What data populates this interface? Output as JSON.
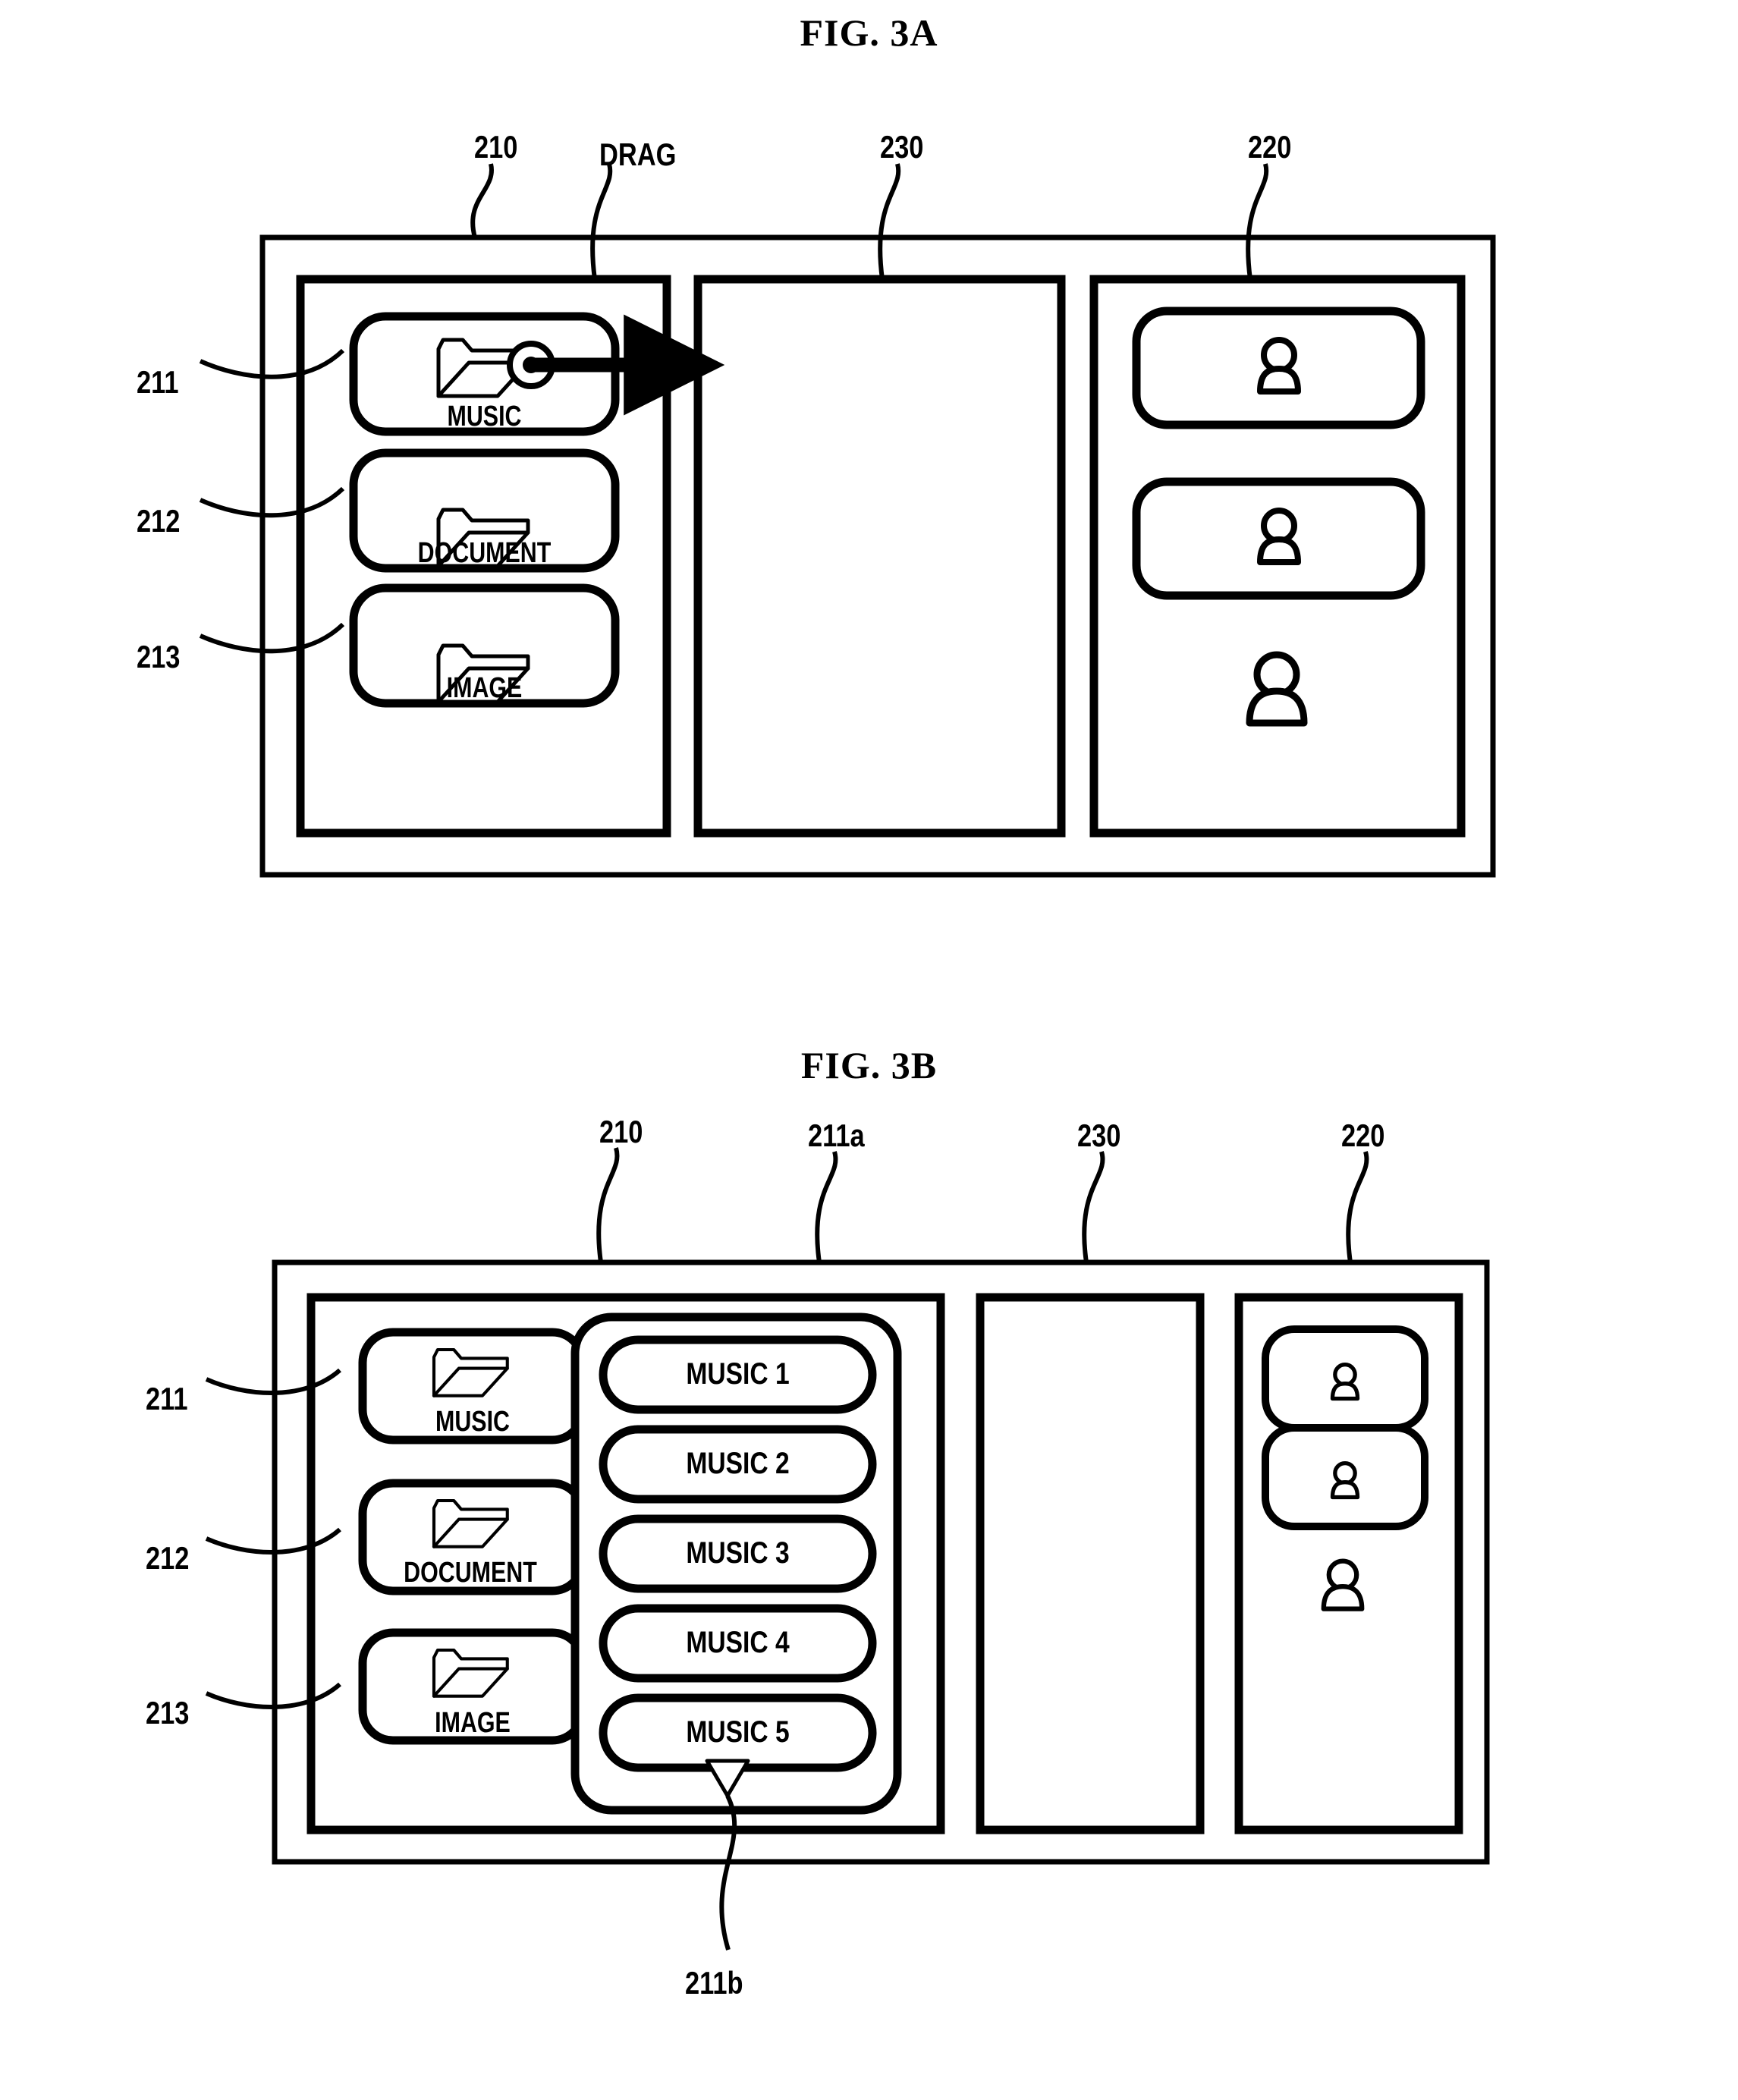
{
  "figures": [
    {
      "id": "fig-3a",
      "title": "FIG. 3A",
      "callouts": [
        {
          "name": "device-frame",
          "text": "210"
        },
        {
          "name": "drag-gesture",
          "text": "DRAG"
        },
        {
          "name": "center-panel",
          "text": "230"
        },
        {
          "name": "right-panel",
          "text": "220"
        },
        {
          "name": "music-folder",
          "text": "211"
        },
        {
          "name": "document-folder",
          "text": "212"
        },
        {
          "name": "image-folder",
          "text": "213"
        }
      ],
      "folders": [
        {
          "name": "music-folder-button",
          "label": "MUSIC",
          "icon": "folder-icon",
          "dragging": true
        },
        {
          "name": "document-folder-button",
          "label": "DOCUMENT",
          "icon": "folder-icon",
          "dragging": false
        },
        {
          "name": "image-folder-button",
          "label": "IMAGE",
          "icon": "folder-icon",
          "dragging": false
        }
      ],
      "users": [
        {
          "name": "user-slot-1",
          "icon": "person-icon",
          "boxed": true
        },
        {
          "name": "user-slot-2",
          "icon": "person-icon",
          "boxed": true
        },
        {
          "name": "user-avatar-3",
          "icon": "person-icon",
          "boxed": false
        }
      ]
    },
    {
      "id": "fig-3b",
      "title": "FIG. 3B",
      "callouts": [
        {
          "name": "device-frame",
          "text": "210"
        },
        {
          "name": "music-popup-list",
          "text": "211a"
        },
        {
          "name": "center-panel",
          "text": "230"
        },
        {
          "name": "right-panel",
          "text": "220"
        },
        {
          "name": "music-folder",
          "text": "211"
        },
        {
          "name": "document-folder",
          "text": "212"
        },
        {
          "name": "image-folder",
          "text": "213"
        },
        {
          "name": "scroll-indicator",
          "text": "211b"
        }
      ],
      "folders": [
        {
          "name": "music-folder-button",
          "label": "MUSIC",
          "icon": "folder-icon"
        },
        {
          "name": "document-folder-button",
          "label": "DOCUMENT",
          "icon": "folder-icon"
        },
        {
          "name": "image-folder-button",
          "label": "IMAGE",
          "icon": "folder-icon"
        }
      ],
      "music_items": [
        {
          "name": "music-item-1",
          "label": "MUSIC 1"
        },
        {
          "name": "music-item-2",
          "label": "MUSIC 2"
        },
        {
          "name": "music-item-3",
          "label": "MUSIC 3"
        },
        {
          "name": "music-item-4",
          "label": "MUSIC 4"
        },
        {
          "name": "music-item-5",
          "label": "MUSIC 5"
        }
      ],
      "scroll_indicator_icon": "triangle-down-icon",
      "users": [
        {
          "name": "user-slot-1",
          "icon": "person-icon",
          "boxed": true
        },
        {
          "name": "user-slot-2",
          "icon": "person-icon",
          "boxed": true
        },
        {
          "name": "user-avatar-3",
          "icon": "person-icon",
          "boxed": false
        }
      ]
    }
  ],
  "colors": {
    "ink": "#000000",
    "paper": "#ffffff"
  }
}
